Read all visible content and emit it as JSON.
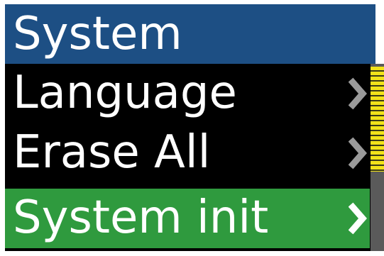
{
  "header": {
    "title": "System"
  },
  "menu": {
    "items": [
      {
        "label": "Language",
        "selected": false
      },
      {
        "label": "Erase All",
        "selected": false
      },
      {
        "label": "System init",
        "selected": true
      }
    ]
  },
  "colors": {
    "header_bg": "#1d4f84",
    "menu_bg": "#000000",
    "selected_bg": "#2f9a3e",
    "arrow_normal": "#9a9a9a",
    "arrow_selected": "#ffffff",
    "scrollbar_track": "#5a5a5a",
    "scrollbar_thumb": "#f2e21a"
  },
  "icons": {
    "submenu_arrow": "chevron-right-icon"
  }
}
